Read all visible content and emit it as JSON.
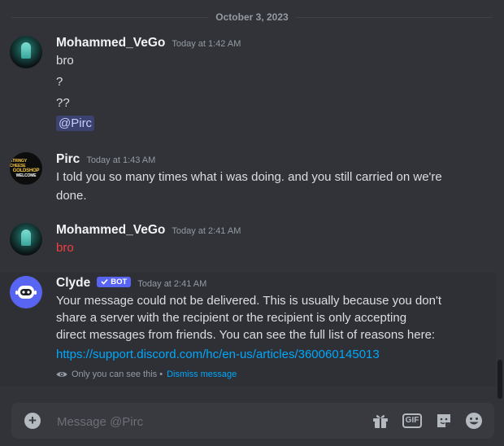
{
  "date_divider": "October 3, 2023",
  "messages": [
    {
      "author": "Mohammed_VeGo",
      "timestamp": "Today at 1:42 AM",
      "lines": [
        "bro",
        "?",
        "??"
      ],
      "mention": "@Pirc"
    },
    {
      "author": "Pirc",
      "timestamp": "Today at 1:43 AM",
      "avatar_text": [
        "STRINGY CHEESE",
        "GOLDSHOP",
        "WELCOME"
      ],
      "lines": [
        "I told you so many times what i was doing. and you still carried on we're",
        "done."
      ]
    },
    {
      "author": "Mohammed_VeGo",
      "timestamp": "Today at 2:41 AM",
      "lines": [
        "bro"
      ]
    },
    {
      "author": "Clyde",
      "badge": "BOT",
      "timestamp": "Today at 2:41 AM",
      "lines": [
        "Your message could not be delivered. This is usually because you don't",
        "share a server with the recipient or the recipient is only accepting",
        "direct messages from friends. You can see the full list of reasons here:"
      ],
      "link": "https://support.discord.com/hc/en-us/articles/360060145013",
      "ephemeral_note": "Only you can see this •",
      "dismiss_label": "Dismiss message"
    }
  ],
  "composer": {
    "placeholder": "Message @Pirc",
    "gif_label": "GIF"
  },
  "icons": [
    "plus-circle-icon",
    "gift-icon",
    "gif-icon",
    "sticker-icon",
    "emoji-icon",
    "eye-icon",
    "check-icon",
    "clyde-robot-icon"
  ],
  "colors": {
    "background": "#313338",
    "accent": "#5865f2",
    "link": "#00a8fc",
    "red_text": "#f23f43",
    "mention_bg": "#3c4270"
  }
}
